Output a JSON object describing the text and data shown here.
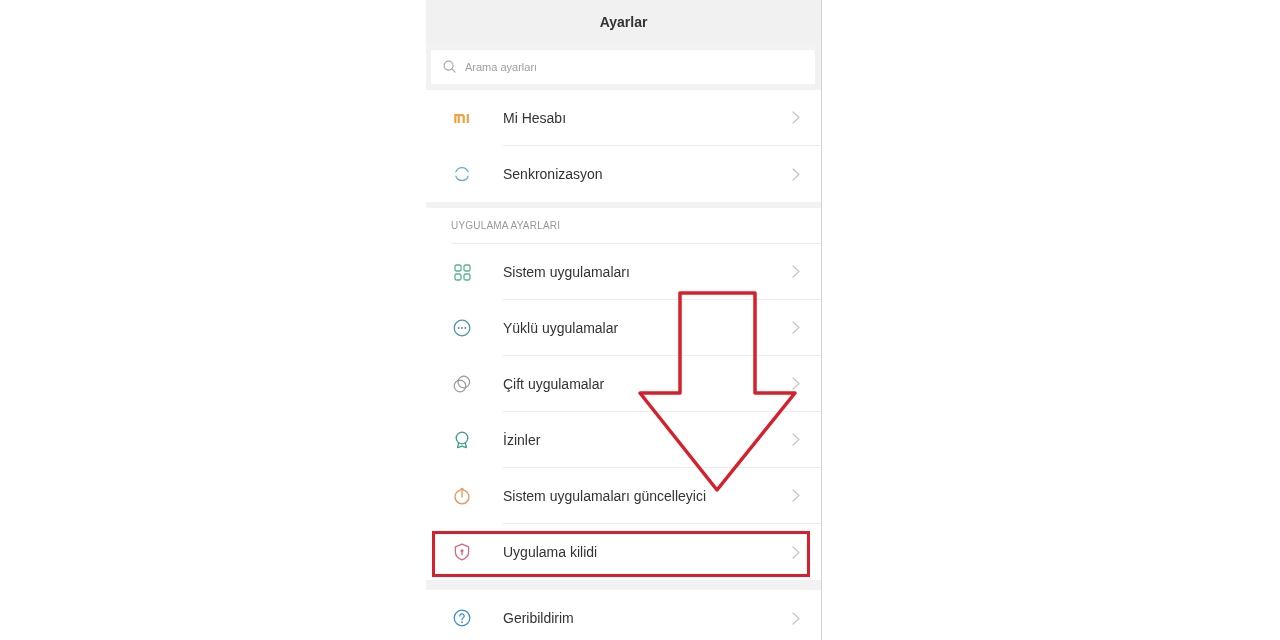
{
  "header": {
    "title": "Ayarlar"
  },
  "search": {
    "placeholder": "Arama ayarları"
  },
  "groups": [
    {
      "items": [
        {
          "label": "Mi Hesabı",
          "highlighted": false
        },
        {
          "label": "Senkronizasyon",
          "highlighted": false
        }
      ]
    },
    {
      "heading": "UYGULAMA AYARLARI",
      "items": [
        {
          "label": "Sistem uygulamaları",
          "highlighted": false
        },
        {
          "label": "Yüklü uygulamalar",
          "highlighted": false
        },
        {
          "label": "Çift uygulamalar",
          "highlighted": false
        },
        {
          "label": "İzinler",
          "highlighted": false
        },
        {
          "label": "Sistem uygulamaları güncelleyici",
          "highlighted": false
        },
        {
          "label": "Uygulama kilidi",
          "highlighted": true
        }
      ]
    },
    {
      "items": [
        {
          "label": "Geribildirim",
          "highlighted": false
        }
      ]
    }
  ]
}
